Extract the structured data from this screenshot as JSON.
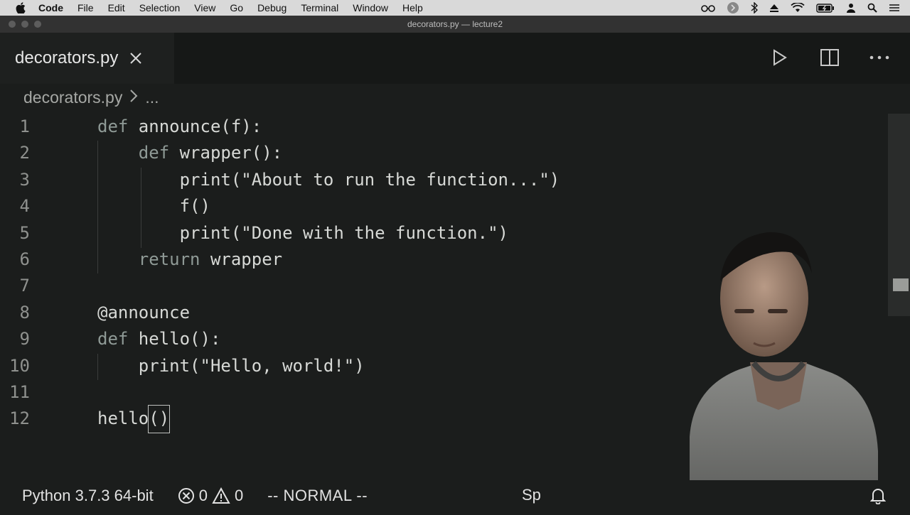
{
  "menubar": {
    "items": [
      "Code",
      "File",
      "Edit",
      "Selection",
      "View",
      "Go",
      "Debug",
      "Terminal",
      "Window",
      "Help"
    ],
    "status_icons": [
      "glasses-icon",
      "siri-icon",
      "bluetooth-icon",
      "eject-icon",
      "wifi-icon",
      "battery-icon",
      "user-icon",
      "search-icon",
      "control-center-icon"
    ]
  },
  "window": {
    "title": "decorators.py — lecture2"
  },
  "tab": {
    "label": "decorators.py"
  },
  "breadcrumb": {
    "file": "decorators.py",
    "more": "..."
  },
  "code": {
    "lines": [
      {
        "n": "1",
        "indent": "",
        "kw": "def",
        "rest": " announce(f):"
      },
      {
        "n": "2",
        "indent": "    ",
        "kw": "def",
        "rest": " wrapper():"
      },
      {
        "n": "3",
        "indent": "        ",
        "kw": "",
        "rest": "print(\"About to run the function...\")"
      },
      {
        "n": "4",
        "indent": "        ",
        "kw": "",
        "rest": "f()"
      },
      {
        "n": "5",
        "indent": "        ",
        "kw": "",
        "rest": "print(\"Done with the function.\")"
      },
      {
        "n": "6",
        "indent": "    ",
        "kw": "return",
        "rest": " wrapper"
      },
      {
        "n": "7",
        "indent": "",
        "kw": "",
        "rest": ""
      },
      {
        "n": "8",
        "indent": "",
        "kw": "",
        "rest": "@announce"
      },
      {
        "n": "9",
        "indent": "",
        "kw": "def",
        "rest": " hello():"
      },
      {
        "n": "10",
        "indent": "    ",
        "kw": "",
        "rest": "print(\"Hello, world!\")"
      },
      {
        "n": "11",
        "indent": "",
        "kw": "",
        "rest": ""
      },
      {
        "n": "12",
        "indent": "",
        "kw": "",
        "rest": "hello",
        "cursor": "()"
      }
    ]
  },
  "statusbar": {
    "python": "Python 3.7.3 64-bit",
    "errors": "0",
    "warnings": "0",
    "mode": "-- NORMAL --",
    "right_partial": "Sp"
  }
}
